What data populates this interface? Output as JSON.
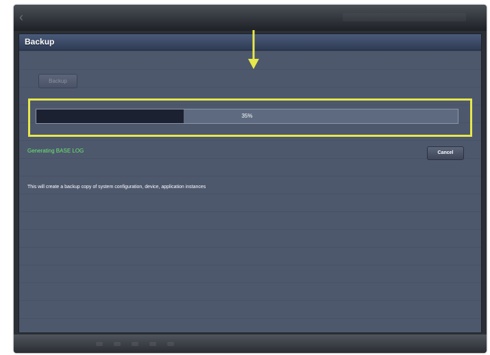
{
  "panel": {
    "title": "Backup",
    "backup_button_label": "Backup",
    "progress": {
      "percent": 35,
      "label": "35%"
    },
    "status_text": "Generating BASE LOG",
    "cancel_button_label": "Cancel",
    "description": "This will create a backup copy of system configuration, device, application instances"
  },
  "topbar": {
    "back_icon": "chevron-left-icon"
  },
  "colors": {
    "panel_bg": "#4d586d",
    "header_bg": "#3a4866",
    "progress_fill": "#1c2132",
    "status_green": "#6ee86e",
    "highlight_yellow": "#e8e84a"
  }
}
